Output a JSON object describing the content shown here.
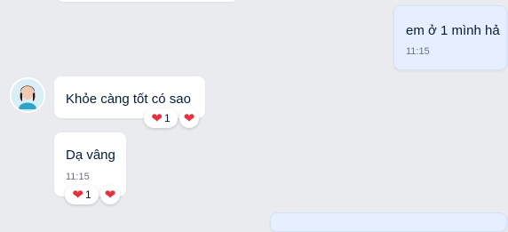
{
  "messages": [
    {
      "text": "em ở 1 mình hả",
      "time": "11:15",
      "sender": "me"
    },
    {
      "text": "Khỏe càng tốt có sao",
      "reaction_count": "1",
      "sender": "contact"
    },
    {
      "text": "Dạ vâng",
      "time": "11:15",
      "reaction_count": "1",
      "sender": "contact"
    }
  ],
  "reaction_icon": "heart-icon",
  "colors": {
    "background": "#eaebef",
    "mine_bubble": "#e5efff",
    "their_bubble": "#ffffff",
    "heart": "#e5303d"
  }
}
